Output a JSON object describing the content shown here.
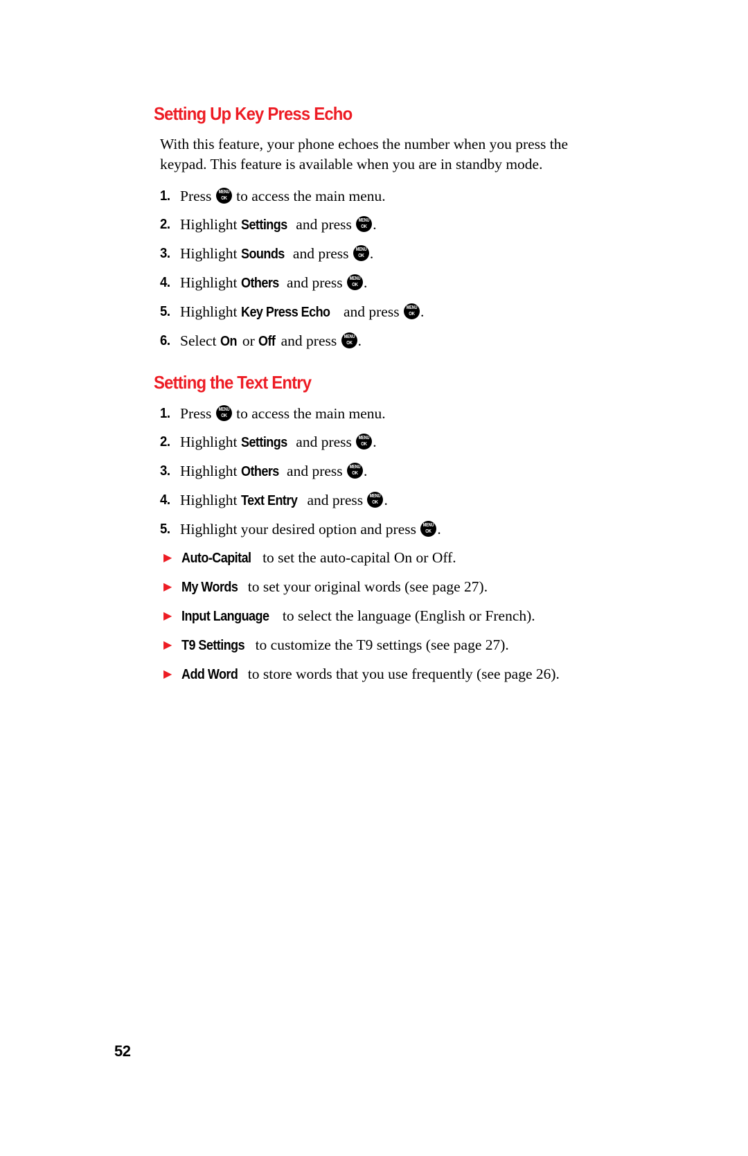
{
  "document": {
    "page_number": "52",
    "accent_color": "#ED1C24",
    "text_color": "#000000"
  },
  "key_icon": {
    "top_label": "MENU",
    "bottom_label": "OK"
  },
  "sections": [
    {
      "heading": "Setting Up Key Press Echo",
      "intro": "With this feature, your phone echoes the number when you press the keypad. This feature is available when you are in standby mode.",
      "steps": [
        {
          "num": "1.",
          "pre": "Press ",
          "kw": "",
          "mid": "",
          "post": " to access the main menu.",
          "icon_after_pre": true
        },
        {
          "num": "2.",
          "pre": "Highlight ",
          "kw": "Settings",
          "mid": " and press ",
          "post": "."
        },
        {
          "num": "3.",
          "pre": "Highlight ",
          "kw": "Sounds",
          "mid": " and press ",
          "post": "."
        },
        {
          "num": "4.",
          "pre": "Highlight ",
          "kw": "Others",
          "mid": " and press ",
          "post": "."
        },
        {
          "num": "5.",
          "pre": "Highlight ",
          "kw": "Key Press Echo",
          "mid": " and press ",
          "post": "."
        },
        {
          "num": "6.",
          "pre": "Select ",
          "kw": "On",
          "mid2": " or ",
          "kw2": "Off",
          "mid": " and press ",
          "post": "."
        }
      ]
    },
    {
      "heading": "Setting the Text Entry",
      "steps": [
        {
          "num": "1.",
          "pre": "Press ",
          "kw": "",
          "mid": "",
          "post": " to access the main menu.",
          "icon_after_pre": true
        },
        {
          "num": "2.",
          "pre": "Highlight ",
          "kw": "Settings",
          "mid": " and press ",
          "post": "."
        },
        {
          "num": "3.",
          "pre": "Highlight ",
          "kw": "Others",
          "mid": " and press ",
          "post": "."
        },
        {
          "num": "4.",
          "pre": "Highlight ",
          "kw": "Text Entry",
          "mid": " and press ",
          "post": "."
        },
        {
          "num": "5.",
          "pre": "Highlight your desired option and press ",
          "kw": "",
          "mid": "",
          "post": ".",
          "icon_after_pre": true
        }
      ],
      "subitems": [
        {
          "bullet": "▶",
          "kw": "Auto-Capital",
          "text": " to set the auto-capital On or Off."
        },
        {
          "bullet": "▶",
          "kw": "My Words",
          "text": " to set your original words (see page 27)."
        },
        {
          "bullet": "▶",
          "kw": "Input Language",
          "text": " to select the language (English or French)."
        },
        {
          "bullet": "▶",
          "kw": "T9 Settings",
          "text": " to customize the T9 settings (see page 27)."
        },
        {
          "bullet": "▶",
          "kw": "Add Word",
          "text": " to store words that you use frequently (see page 26)."
        }
      ]
    }
  ]
}
